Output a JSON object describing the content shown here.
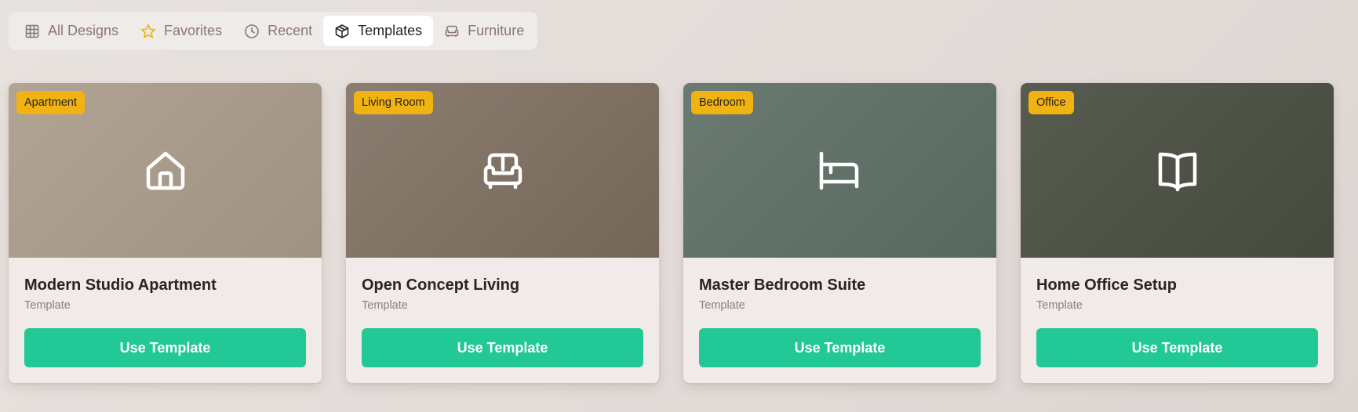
{
  "tabs": [
    {
      "label": "All Designs",
      "icon": "grid-icon",
      "active": false
    },
    {
      "label": "Favorites",
      "icon": "star-icon",
      "active": false
    },
    {
      "label": "Recent",
      "icon": "clock-icon",
      "active": false
    },
    {
      "label": "Templates",
      "icon": "cube-icon",
      "active": true
    },
    {
      "label": "Furniture",
      "icon": "sofa-icon",
      "active": false
    }
  ],
  "colors": {
    "accent": "#22c896",
    "badge": "#f0b311",
    "favorite_star": "#f0b311"
  },
  "cards": [
    {
      "badge": "Apartment",
      "title": "Modern Studio Apartment",
      "subtitle": "Template",
      "button": "Use Template",
      "icon": "house-icon",
      "gradient": [
        "#b2a495",
        "#a09282"
      ]
    },
    {
      "badge": "Living Room",
      "title": "Open Concept Living",
      "subtitle": "Template",
      "button": "Use Template",
      "icon": "sofa-icon",
      "gradient": [
        "#8b7d70",
        "#746658"
      ]
    },
    {
      "badge": "Bedroom",
      "title": "Master Bedroom Suite",
      "subtitle": "Template",
      "button": "Use Template",
      "icon": "bed-icon",
      "gradient": [
        "#6b7a72",
        "#58685f"
      ]
    },
    {
      "badge": "Office",
      "title": "Home Office Setup",
      "subtitle": "Template",
      "button": "Use Template",
      "icon": "book-icon",
      "gradient": [
        "#585c50",
        "#464a3e"
      ]
    }
  ]
}
